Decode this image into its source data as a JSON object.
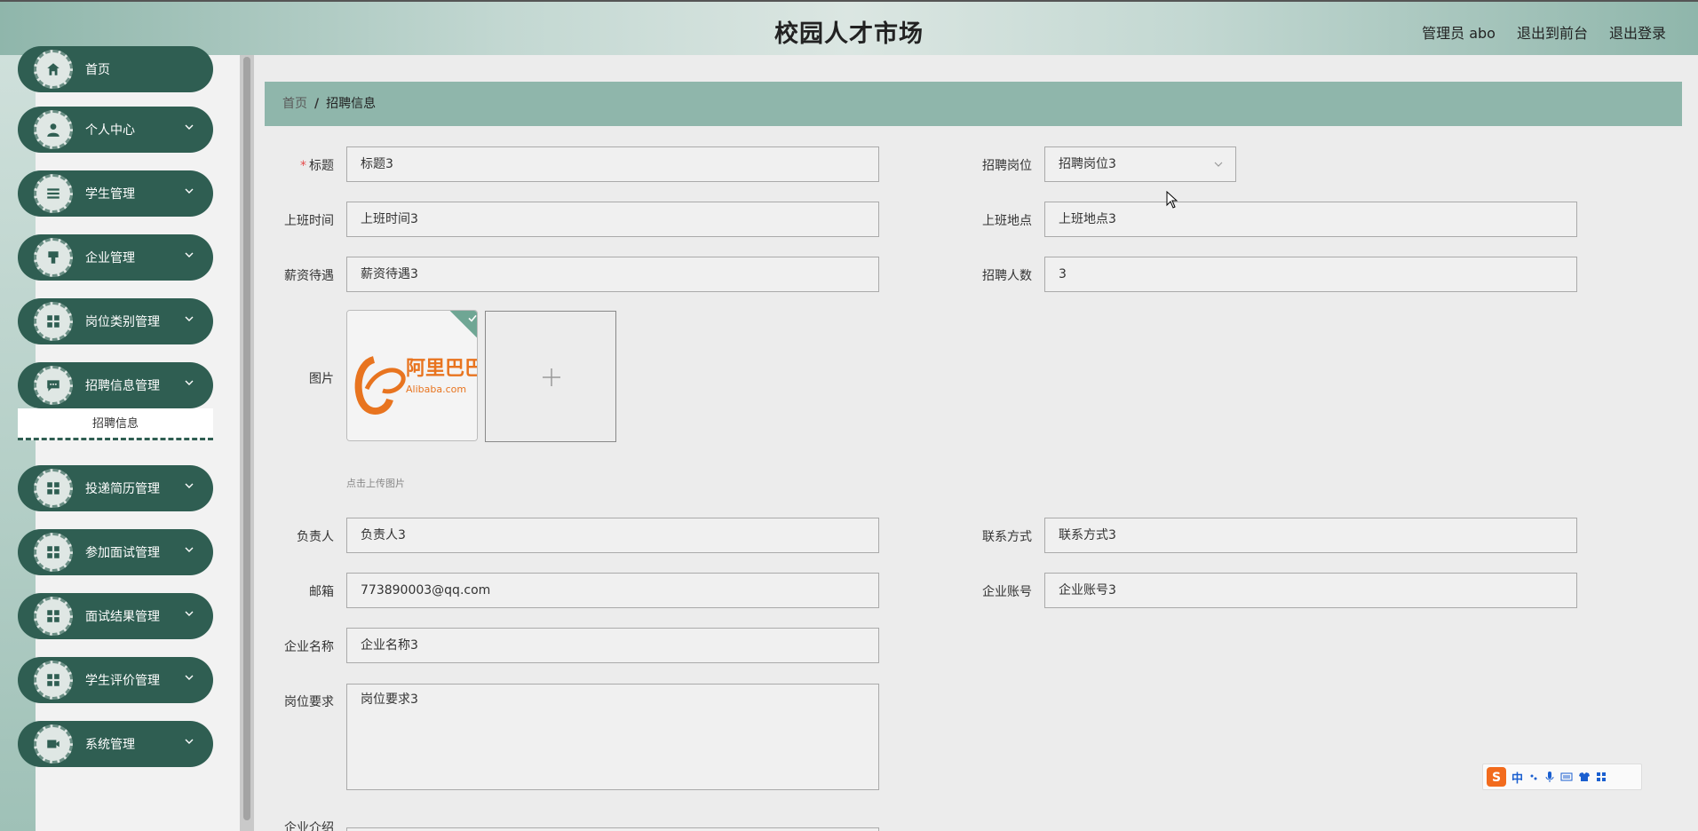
{
  "header": {
    "title": "校园人才市场",
    "admin": "管理员 abo",
    "back_to_front": "退出到前台",
    "logout": "退出登录"
  },
  "sidebar": {
    "items": [
      {
        "label": "首页",
        "icon": "home-icon"
      },
      {
        "label": "个人中心",
        "icon": "user-icon"
      },
      {
        "label": "学生管理",
        "icon": "list-icon"
      },
      {
        "label": "企业管理",
        "icon": "building-icon"
      },
      {
        "label": "岗位类别管理",
        "icon": "grid-icon"
      },
      {
        "label": "招聘信息管理",
        "icon": "message-icon"
      },
      {
        "label": "投递简历管理",
        "icon": "grid-icon"
      },
      {
        "label": "参加面试管理",
        "icon": "grid-icon"
      },
      {
        "label": "面试结果管理",
        "icon": "grid-icon"
      },
      {
        "label": "学生评价管理",
        "icon": "grid-icon"
      },
      {
        "label": "系统管理",
        "icon": "video-icon"
      }
    ],
    "active_sub": "招聘信息"
  },
  "breadcrumb": {
    "home": "首页",
    "separator": "/",
    "current": "招聘信息"
  },
  "form": {
    "title_label": "标题",
    "title_required_mark": "*",
    "title_value": "标题3",
    "position_label": "招聘岗位",
    "position_value": "招聘岗位3",
    "work_time_label": "上班时间",
    "work_time_value": "上班时间3",
    "work_place_label": "上班地点",
    "work_place_value": "上班地点3",
    "salary_label": "薪资待遇",
    "salary_value": "薪资待遇3",
    "headcount_label": "招聘人数",
    "headcount_value": "3",
    "image_label": "图片",
    "upload_hint": "点击上传图片",
    "logo_text_cn": "阿里巴巴",
    "logo_text_en": "Alibaba.com",
    "manager_label": "负责人",
    "manager_value": "负责人3",
    "contact_label": "联系方式",
    "contact_value": "联系方式3",
    "email_label": "邮箱",
    "email_value": "773890003@qq.com",
    "company_account_label": "企业账号",
    "company_account_value": "企业账号3",
    "company_name_label": "企业名称",
    "company_name_value": "企业名称3",
    "requirement_label": "岗位要求",
    "requirement_value": "岗位要求3",
    "intro_label": "企业介绍"
  },
  "ime": {
    "mode": "中"
  },
  "colors": {
    "accent": "#2f5e52",
    "breadcrumb_bg": "#8fb6ab"
  }
}
